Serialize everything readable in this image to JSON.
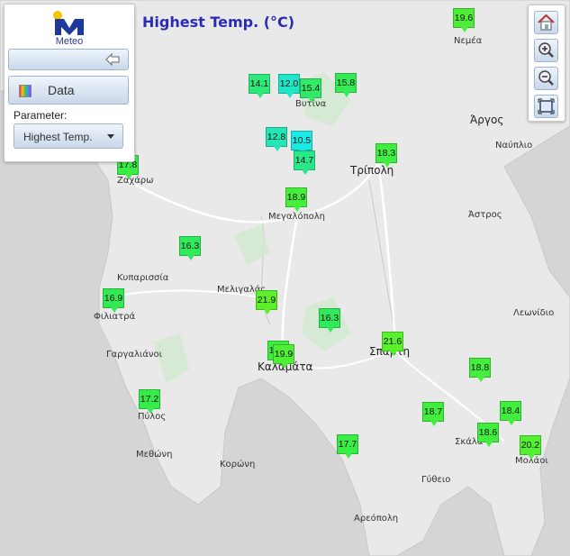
{
  "title": "Highest Temp. (°C)",
  "logo_text": "Meteo",
  "panel": {
    "data_label": "Data",
    "parameter_label": "Parameter:",
    "parameter_value": "Highest Temp."
  },
  "toolbar": {
    "icons": [
      "home-icon",
      "zoom-in-icon",
      "zoom-out-icon",
      "zoom-extent-icon"
    ]
  },
  "colors": {
    "title": "#2b2bb8",
    "land": "#e8e8e8",
    "sea": "#d4d4d4",
    "marker_cyan": "#22e8e0",
    "marker_green": "#33ee33"
  },
  "stations": [
    {
      "value": "19.6",
      "color": "#4cee3a"
    },
    {
      "value": "14.1",
      "color": "#2ee87a"
    },
    {
      "value": "12.0",
      "color": "#20e6c8"
    },
    {
      "value": "15.4",
      "color": "#33ea66"
    },
    {
      "value": "15.8",
      "color": "#33ec55"
    },
    {
      "value": "12.8",
      "color": "#22e6b4"
    },
    {
      "value": "10.5",
      "color": "#1ce8e4"
    },
    {
      "value": "14.7",
      "color": "#2ae88a"
    },
    {
      "value": "18.3",
      "color": "#3fee40"
    },
    {
      "value": "17.8",
      "color": "#38ed44"
    },
    {
      "value": "18.9",
      "color": "#44ee3c"
    },
    {
      "value": "16.3",
      "color": "#30ea5c"
    },
    {
      "value": "16.9",
      "color": "#33ea55"
    },
    {
      "value": "21.9",
      "color": "#5cf02a"
    },
    {
      "value": "16.3",
      "color": "#30ea5c"
    },
    {
      "value": "21.6",
      "color": "#5af02c"
    },
    {
      "value": "18.0",
      "color": "#3cee42"
    },
    {
      "value": "19.9",
      "color": "#4eef36"
    },
    {
      "value": "18.8",
      "color": "#43ee3c"
    },
    {
      "value": "17.2",
      "color": "#36ec4a"
    },
    {
      "value": "18.7",
      "color": "#42ee3d"
    },
    {
      "value": "18.4",
      "color": "#40ee3e"
    },
    {
      "value": "18.6",
      "color": "#41ee3d"
    },
    {
      "value": "17.7",
      "color": "#38ed45"
    },
    {
      "value": "20.2",
      "color": "#52ef33"
    }
  ],
  "towns": [
    "Νεμέα",
    "Βυτίνα",
    "Άργος",
    "Ναύπλιο",
    "Τρίπολη",
    "Ζαχάρω",
    "Άστρος",
    "Μεγαλόπολη",
    "Κυπαρισσία",
    "Μελιγαλάς",
    "Φιλιατρά",
    "Λεωνίδιο",
    "Γαργαλιάνοι",
    "Σπάρτη",
    "Καλαμάτα",
    "Πύλος",
    "Σκάλα",
    "Μεθώνη",
    "Κορώνη",
    "Μολάοι",
    "Γύθειο",
    "Αρεόπολη"
  ]
}
